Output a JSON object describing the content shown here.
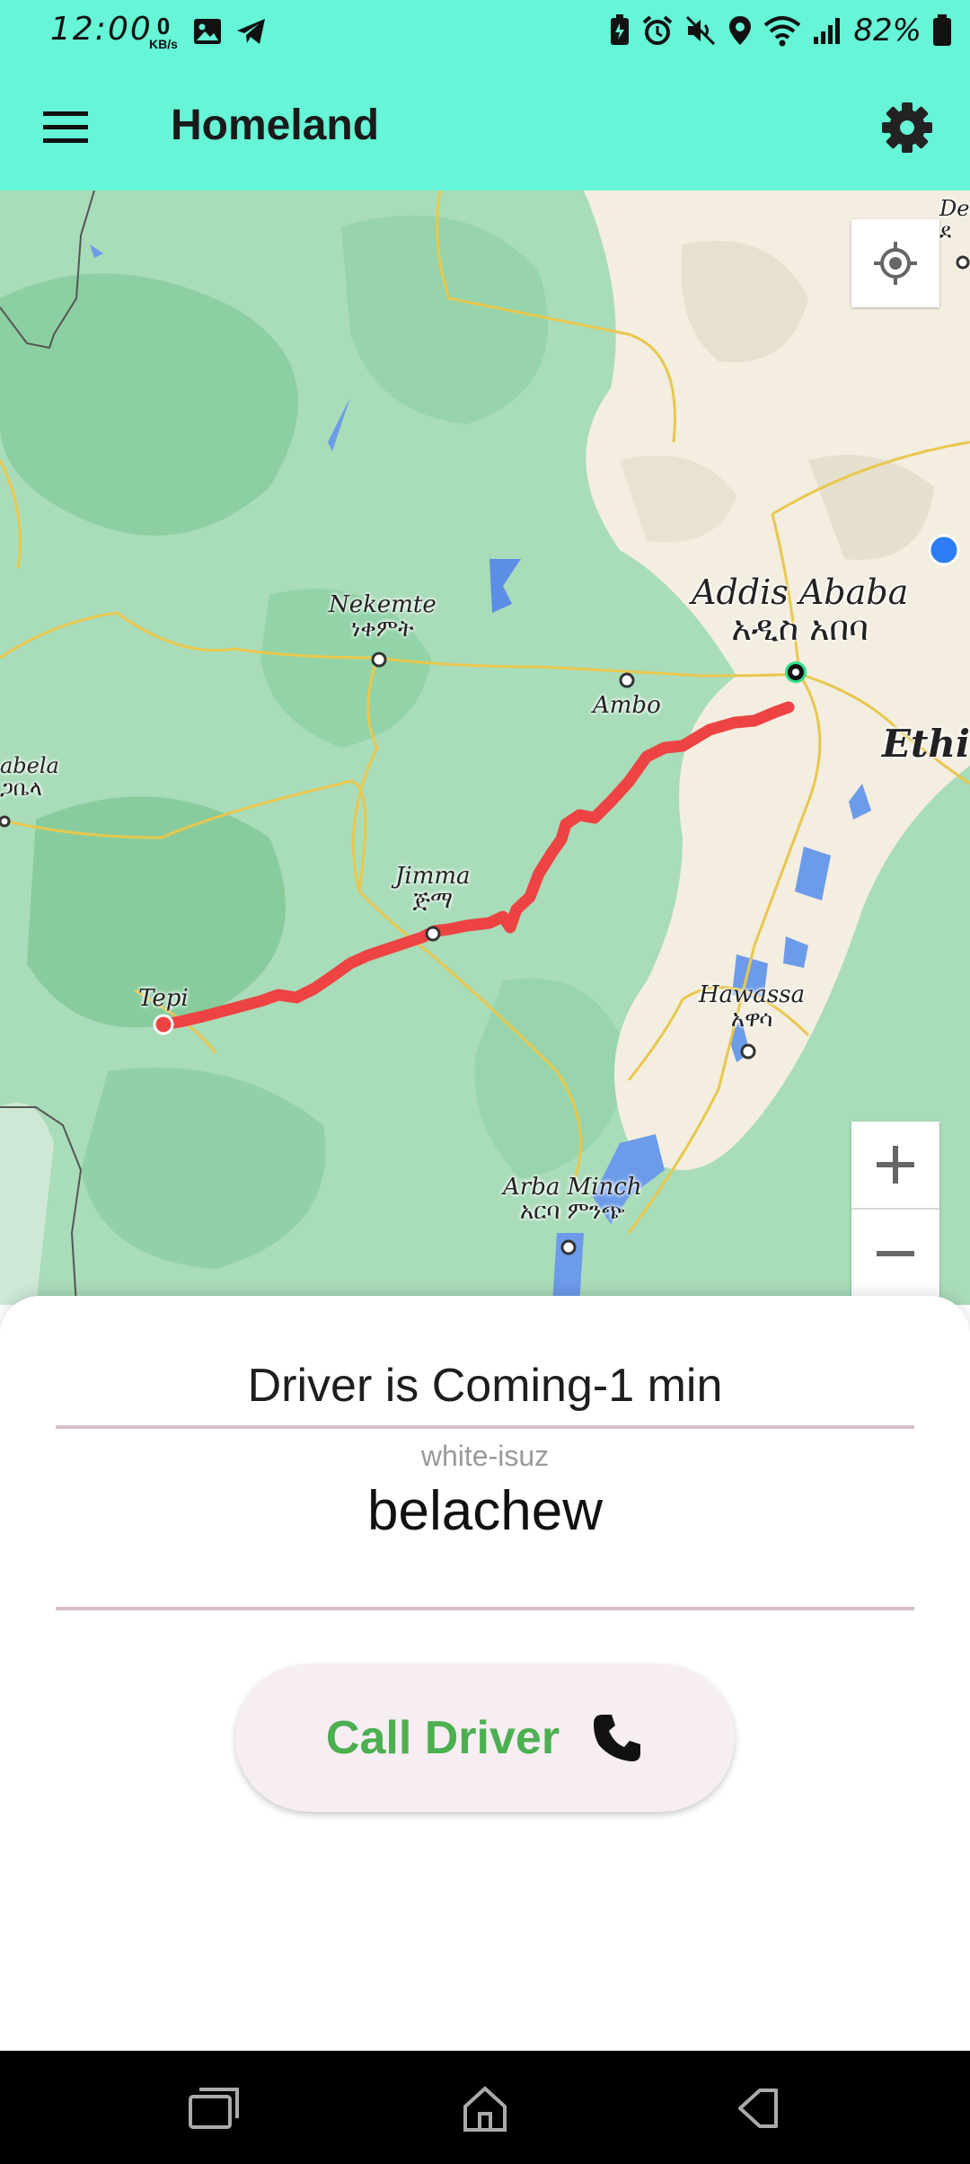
{
  "status_bar": {
    "time": "12:00",
    "speed_value": "0",
    "speed_unit": "KB/s",
    "battery": "82%",
    "left_icons": [
      "gallery-icon",
      "telegram-icon"
    ],
    "right_icons": [
      "battery-saver-icon",
      "alarm-icon",
      "mute-icon",
      "location-icon",
      "wifi-icon",
      "signal-icon",
      "battery-icon"
    ]
  },
  "app_bar": {
    "title": "Homeland",
    "background": "#66f5d6"
  },
  "map": {
    "route_color": "#f04444",
    "cities": [
      {
        "name": "Addis Ababa",
        "local": "አዲስ አበባ"
      },
      {
        "name": "Nekemte",
        "local": "ነቀምት"
      },
      {
        "name": "Ambo",
        "local": ""
      },
      {
        "name": "Jimma",
        "local": "ጅማ"
      },
      {
        "name": "Tepi",
        "local": ""
      },
      {
        "name": "Hawassa",
        "local": "አዋሳ"
      },
      {
        "name": "Arba Minch",
        "local": "አርባ ምንጭ"
      },
      {
        "name": "Ethio",
        "local": ""
      },
      {
        "name": "abela",
        "local": "ጋቤላ"
      },
      {
        "name": "De",
        "local": "ደ"
      }
    ],
    "controls": {
      "zoom_in": "+",
      "zoom_out": "−"
    }
  },
  "trip": {
    "status": "Driver is Coming-1 min",
    "vehicle": "white-isuz",
    "driver_name": "belachew",
    "call_label": "Call Driver",
    "accent": "#4caf50"
  }
}
